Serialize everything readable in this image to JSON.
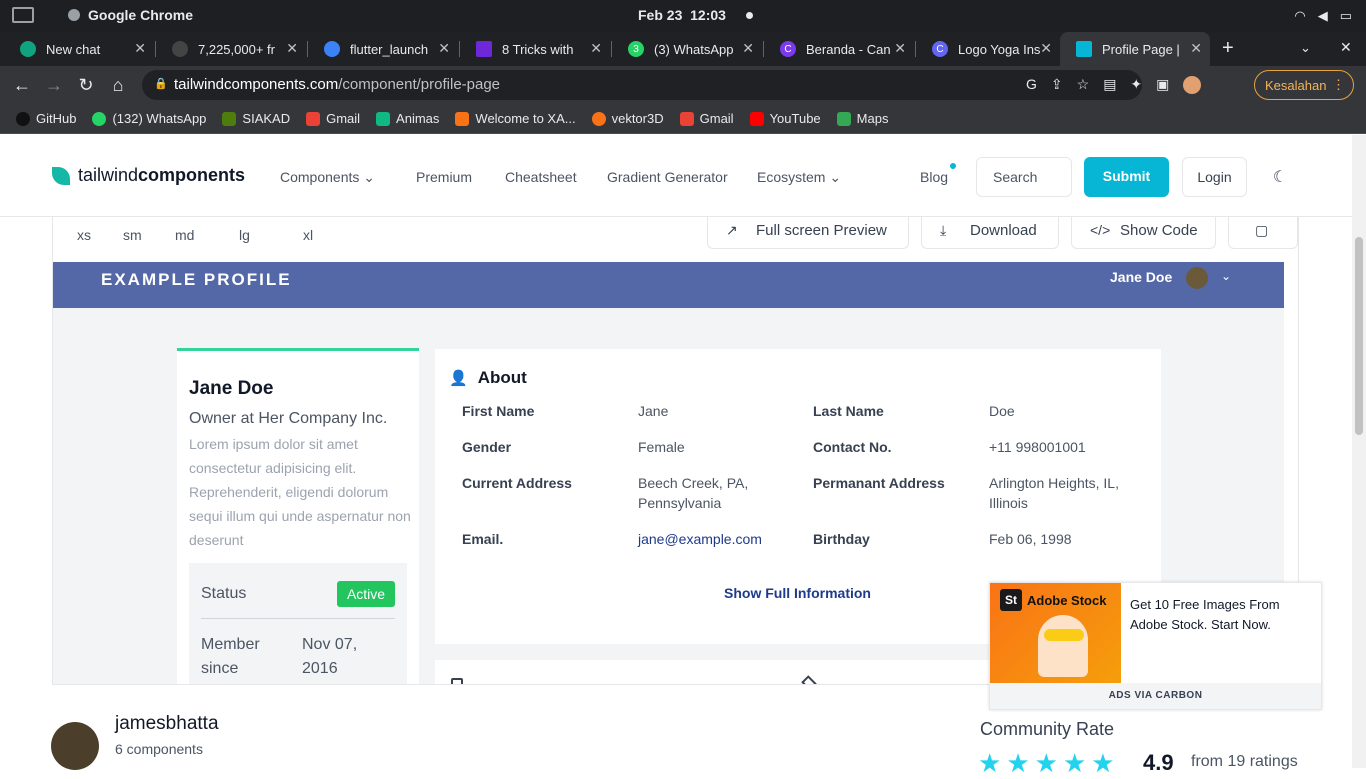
{
  "os": {
    "app_name": "Google Chrome",
    "date": "Feb 23",
    "time": "12:03"
  },
  "tabs": [
    {
      "label": "New chat",
      "icon": "openai-icon",
      "color": "#10a37f"
    },
    {
      "label": "7,225,000+ fr",
      "icon": "tab-icon",
      "color": "#444"
    },
    {
      "label": "flutter_launch",
      "icon": "flutter-icon",
      "color": "#3b82f6"
    },
    {
      "label": "8 Tricks with",
      "icon": "tab-icon",
      "color": "#6d28d9"
    },
    {
      "label": "(3) WhatsApp",
      "icon": "whatsapp-icon",
      "color": "#25d366"
    },
    {
      "label": "Beranda - Can",
      "icon": "canva-icon",
      "color": "#7c3aed"
    },
    {
      "label": "Logo Yoga Ins",
      "icon": "canva-icon",
      "color": "#6366f1"
    },
    {
      "label": "Profile Page |",
      "icon": "tailwind-icon",
      "color": "#06b6d4"
    }
  ],
  "address": {
    "domain": "tailwindcomponents.com",
    "path": "/component/profile-page",
    "error_label": "Kesalahan"
  },
  "bookmarks": [
    {
      "label": "GitHub",
      "color": "#111"
    },
    {
      "label": "(132) WhatsApp",
      "color": "#25d366"
    },
    {
      "label": "SIAKAD",
      "color": "#4d7c0f"
    },
    {
      "label": "Gmail",
      "color": "#ea4335"
    },
    {
      "label": "Animas",
      "color": "#10b981"
    },
    {
      "label": "Welcome to XA...",
      "color": "#f97316"
    },
    {
      "label": "vektor3D",
      "color": "#f97316"
    },
    {
      "label": "Gmail",
      "color": "#ea4335"
    },
    {
      "label": "YouTube",
      "color": "#ff0000"
    },
    {
      "label": "Maps",
      "color": "#34a853"
    }
  ],
  "site": {
    "logo_light": "tailwind",
    "logo_bold": "components",
    "nav": {
      "components": "Components",
      "premium": "Premium",
      "cheatsheet": "Cheatsheet",
      "gradient": "Gradient Generator",
      "ecosystem": "Ecosystem",
      "blog": "Blog"
    },
    "search_placeholder": "Search",
    "submit": "Submit",
    "login": "Login"
  },
  "toolbar": {
    "bp_xs": "xs",
    "bp_sm": "sm",
    "bp_md": "md",
    "bp_lg": "lg",
    "bp_xl": "xl",
    "fullscreen": "Full screen Preview",
    "download": "Download",
    "show_code": "Show Code"
  },
  "profile": {
    "nav_title": "EXAMPLE PROFILE",
    "nav_user": "Jane Doe",
    "name": "Jane Doe",
    "position": "Owner at Her Company Inc.",
    "description": "Lorem ipsum dolor sit amet consectetur adipisicing elit. Reprehenderit, eligendi dolorum sequi illum qui unde aspernatur non deserunt",
    "status_label": "Status",
    "status_value": "Active",
    "member_label": "Member since",
    "member_value": "Nov 07, 2016",
    "about_title": "About",
    "fields": {
      "first_name_label": "First Name",
      "first_name": "Jane",
      "last_name_label": "Last Name",
      "last_name": "Doe",
      "gender_label": "Gender",
      "gender": "Female",
      "contact_label": "Contact No.",
      "contact": "+11 998001001",
      "current_addr_label": "Current Address",
      "current_addr": "Beech Creek, PA, Pennsylvania",
      "perm_addr_label": "Permanant Address",
      "perm_addr": "Arlington Heights, IL, Illinois",
      "email_label": "Email.",
      "email": "jane@example.com",
      "birthday_label": "Birthday",
      "birthday": "Feb 06, 1998"
    },
    "show_full": "Show Full Information"
  },
  "ad": {
    "brand": "Adobe Stock",
    "text": "Get 10 Free Images From Adobe Stock. Start Now.",
    "via": "ADS VIA CARBON"
  },
  "author": {
    "name": "jamesbhatta",
    "components": "6 components"
  },
  "rating": {
    "label": "Community Rate",
    "value": "4.9",
    "count": "from 19 ratings",
    "stars": 5
  }
}
